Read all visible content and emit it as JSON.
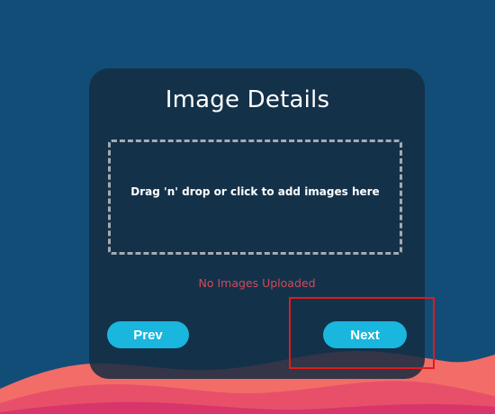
{
  "page": {
    "background_color": "#124d77"
  },
  "card": {
    "title": "Image Details",
    "dropzone_text": "Drag 'n' drop or click to add images here",
    "status_text": "No Images Uploaded",
    "status_color": "#d14a5a"
  },
  "buttons": {
    "prev_label": "Prev",
    "next_label": "Next",
    "accent_color": "#19b6dd"
  },
  "annotation": {
    "highlight_color": "#e01b1b"
  }
}
